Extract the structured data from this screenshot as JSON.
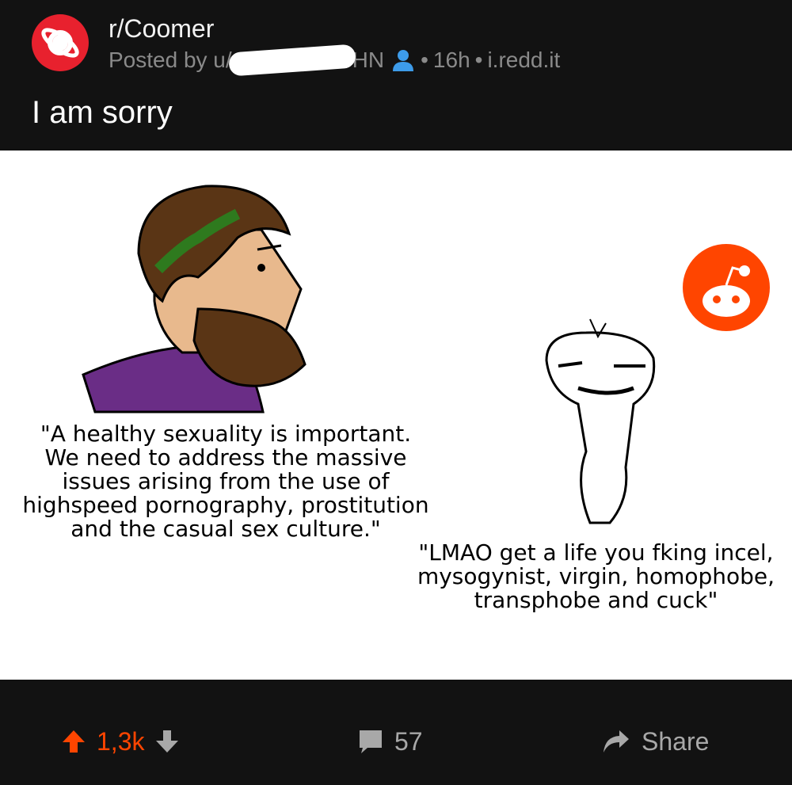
{
  "post": {
    "subreddit": "r/Coomer",
    "posted_by_prefix": "Posted by u/",
    "username_visible_suffix": "HN",
    "time": "16h",
    "domain": "i.redd.it",
    "separator": "•",
    "title": "I am sorry"
  },
  "meme": {
    "left_caption": "\"A healthy sexuality is important.\nWe need to address the massive\nissues arising from the use of\nhighspeed pornography, prostitution\nand the casual sex culture.\"",
    "right_caption": "\"LMAO get a life you fking incel,\nmysogynist, virgin, homophobe,\ntransphobe and cuck\""
  },
  "actions": {
    "upvote_count": "1,3k",
    "comment_count": "57",
    "share_label": "Share"
  },
  "colors": {
    "background": "#121212",
    "subreddit_avatar": "#e8212e",
    "upvote_accent": "#ff4500",
    "user_icon": "#3d9be9",
    "reddit_logo": "#ff4500"
  }
}
